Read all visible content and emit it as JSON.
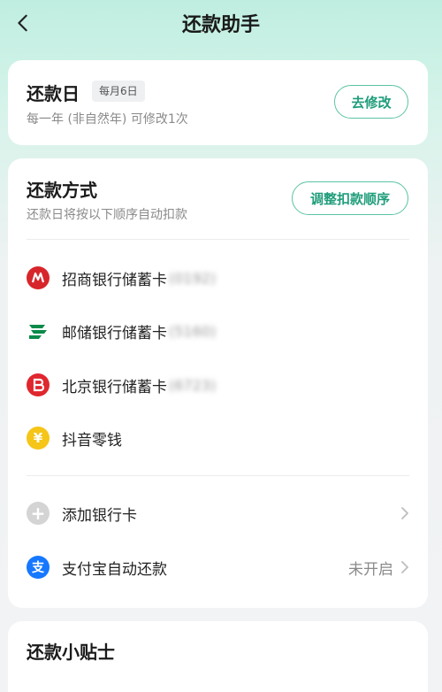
{
  "header": {
    "title": "还款助手"
  },
  "repay_day": {
    "title": "还款日",
    "badge": "每月6日",
    "note": "每一年 (非自然年) 可修改1次",
    "button": "去修改"
  },
  "repay_method": {
    "title": "还款方式",
    "note": "还款日将按以下顺序自动扣款",
    "button": "调整扣款顺序",
    "accounts": [
      {
        "label": "招商银行储蓄卡",
        "masked": "(0192)",
        "icon": "cmb-bank-icon",
        "color": "#d7262b"
      },
      {
        "label": "邮储银行储蓄卡",
        "masked": "(5160)",
        "icon": "psbc-bank-icon",
        "color": "#0b8a4a"
      },
      {
        "label": "北京银行储蓄卡",
        "masked": "(6723)",
        "icon": "bob-bank-icon",
        "color": "#e0262e"
      },
      {
        "label": "抖音零钱",
        "masked": "",
        "icon": "yuan-coin-icon",
        "color": "#f5c518"
      }
    ],
    "add_card": {
      "label": "添加银行卡",
      "icon": "plus-icon"
    },
    "alipay": {
      "label": "支付宝自动还款",
      "status": "未开启",
      "icon": "alipay-icon",
      "color": "#1677ff"
    }
  },
  "tips": {
    "title": "还款小贴士"
  }
}
